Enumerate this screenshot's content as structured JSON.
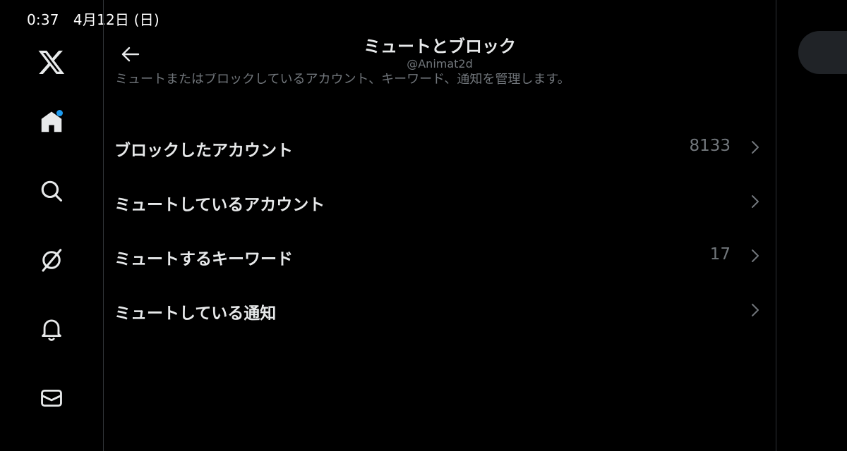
{
  "status_bar": {
    "time": "0:37　4月12日 (日)"
  },
  "header": {
    "title": "ミュートとブロック",
    "handle": "@Animat2d",
    "description": "ミュートまたはブロックしているアカウント、キーワード、通知を管理します。"
  },
  "nav": [
    {
      "name": "x-logo-icon"
    },
    {
      "name": "home-icon",
      "has_notification": true
    },
    {
      "name": "search-icon"
    },
    {
      "name": "grok-icon"
    },
    {
      "name": "bell-icon"
    },
    {
      "name": "mail-icon"
    }
  ],
  "items": [
    {
      "label": "ブロックしたアカウント",
      "value": "8133"
    },
    {
      "label": "ミュートしているアカウント",
      "value": ""
    },
    {
      "label": "ミュートするキーワード",
      "value": "17"
    },
    {
      "label": "ミュートしている通知",
      "value": ""
    }
  ],
  "colors": {
    "background": "#000000",
    "text": "#e7e9ea",
    "muted": "#71767b",
    "accent": "#1d9bf0",
    "divider": "#2f3336"
  }
}
